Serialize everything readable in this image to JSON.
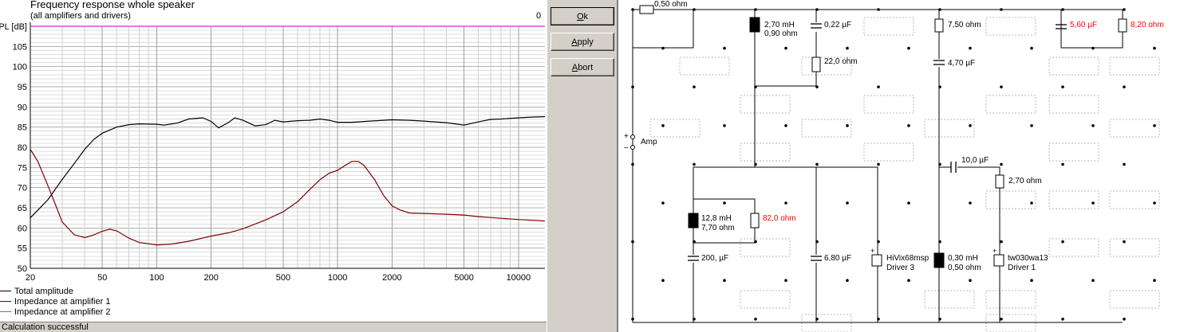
{
  "chart": {
    "title": "Frequency response whole speaker",
    "subtitle": "(all amplifiers and drivers)",
    "clipped_label": "0",
    "status_text": "Calculation successful"
  },
  "chart_data": {
    "type": "line",
    "title": "Frequency response whole speaker",
    "subtitle": "(all amplifiers and drivers)",
    "ylabel": "SPL [dB]",
    "xlabel": "",
    "x_scale": "log",
    "xlim": [
      20,
      14000
    ],
    "ylim": [
      50,
      110
    ],
    "x_ticks": [
      "20",
      "50",
      "100",
      "200",
      "500",
      "1000",
      "2000",
      "5000",
      "10000"
    ],
    "y_ticks": [
      "50",
      "55",
      "60",
      "65",
      "70",
      "75",
      "80",
      "85",
      "90",
      "95",
      "100",
      "105"
    ],
    "grid": true,
    "legend_placement": "bottom-left",
    "series": [
      {
        "name": "Total amplitude",
        "color": "#000000",
        "points": [
          [
            20,
            62.5
          ],
          [
            25,
            67
          ],
          [
            30,
            72
          ],
          [
            35,
            76
          ],
          [
            40,
            79.5
          ],
          [
            45,
            82
          ],
          [
            50,
            83.5
          ],
          [
            60,
            85
          ],
          [
            70,
            85.6
          ],
          [
            80,
            85.8
          ],
          [
            100,
            85.7
          ],
          [
            110,
            85.5
          ],
          [
            130,
            86
          ],
          [
            150,
            87
          ],
          [
            180,
            87.3
          ],
          [
            200,
            86.4
          ],
          [
            220,
            84.8
          ],
          [
            250,
            86.2
          ],
          [
            270,
            87.3
          ],
          [
            300,
            86.7
          ],
          [
            350,
            85.3
          ],
          [
            400,
            85.6
          ],
          [
            450,
            86.7
          ],
          [
            500,
            86.3
          ],
          [
            600,
            86.6
          ],
          [
            700,
            86.7
          ],
          [
            800,
            87
          ],
          [
            900,
            86.7
          ],
          [
            1000,
            86.2
          ],
          [
            1200,
            86.2
          ],
          [
            1500,
            86.5
          ],
          [
            2000,
            86.8
          ],
          [
            2500,
            86.7
          ],
          [
            3000,
            86.5
          ],
          [
            4000,
            86.1
          ],
          [
            5000,
            85.5
          ],
          [
            6000,
            86.3
          ],
          [
            7000,
            86.9
          ],
          [
            8000,
            87
          ],
          [
            10000,
            87.3
          ],
          [
            12000,
            87.5
          ],
          [
            14000,
            87.6
          ]
        ]
      },
      {
        "name": "Impedance at amplifier 1",
        "color": "#800000",
        "points": [
          [
            20,
            79.5
          ],
          [
            22,
            76.5
          ],
          [
            25,
            70.5
          ],
          [
            28,
            65
          ],
          [
            30,
            61.5
          ],
          [
            35,
            58.3
          ],
          [
            40,
            57.6
          ],
          [
            45,
            58.3
          ],
          [
            50,
            59.2
          ],
          [
            55,
            59.7
          ],
          [
            60,
            59.3
          ],
          [
            70,
            57.5
          ],
          [
            80,
            56.4
          ],
          [
            100,
            55.8
          ],
          [
            120,
            56
          ],
          [
            150,
            56.7
          ],
          [
            200,
            58
          ],
          [
            250,
            58.8
          ],
          [
            300,
            59.8
          ],
          [
            400,
            62
          ],
          [
            500,
            64
          ],
          [
            600,
            66.5
          ],
          [
            700,
            69.5
          ],
          [
            800,
            72
          ],
          [
            900,
            73.6
          ],
          [
            1000,
            74.3
          ],
          [
            1100,
            75.5
          ],
          [
            1200,
            76.5
          ],
          [
            1300,
            76.5
          ],
          [
            1400,
            75.5
          ],
          [
            1600,
            72
          ],
          [
            1800,
            68
          ],
          [
            2000,
            65.5
          ],
          [
            2200,
            64.5
          ],
          [
            2500,
            63.7
          ],
          [
            3000,
            63.6
          ],
          [
            4000,
            63.4
          ],
          [
            5000,
            63.2
          ],
          [
            6000,
            62.8
          ],
          [
            7000,
            62.6
          ],
          [
            8000,
            62.4
          ],
          [
            10000,
            62.1
          ],
          [
            12000,
            61.9
          ],
          [
            14000,
            61.7
          ]
        ]
      },
      {
        "name": "Impedance at amplifier 2",
        "color": "#cc33cc",
        "points": [
          [
            20,
            110
          ],
          [
            14000,
            110
          ]
        ]
      }
    ]
  },
  "buttons": {
    "ok": {
      "pre": "",
      "ul": "O",
      "post": "k"
    },
    "apply": {
      "pre": "",
      "ul": "A",
      "post": "pply"
    },
    "abort": {
      "pre": "",
      "ul": "A",
      "post": "bort"
    }
  },
  "circuit": {
    "labels": {
      "r_050": "0,50 ohm",
      "l1_a": "2,70 mH",
      "l1_b": "0,90 ohm",
      "c_022": "0,22 µF",
      "r_22": "22,0 ohm",
      "r_750": "7,50 ohm",
      "c_470": "4,70 µF",
      "c_560": "5,60 µF",
      "r_820": "8,20 ohm",
      "amp": "Amp",
      "plus": "+",
      "minus": "−",
      "c_10": "10,0 µF",
      "r_270": "2,70 ohm",
      "l2_a": "12,8 mH",
      "l2_b": "7,70 ohm",
      "r_82": "82,0 ohm",
      "c_200": "200, µF",
      "c_680": "6,80 µF",
      "drv3_a": "HiVix68msp",
      "drv3_b": "Driver 3",
      "l3_a": "0,30 mH",
      "l3_b": "0,50 ohm",
      "drv1_a": "tw030wa13",
      "drv1_b": "Driver 1"
    },
    "red_color": "#ff0000"
  }
}
